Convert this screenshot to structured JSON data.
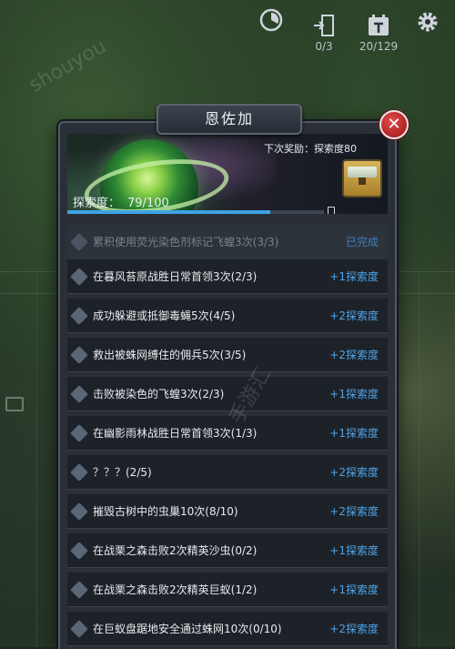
{
  "hud": {
    "exit_count": "0/3",
    "calendar_count": "20/129"
  },
  "dialog": {
    "title": "恩佐加",
    "close_label": "✕",
    "next_reward": "下次奖励：探索度80",
    "progress_label": "探索度：",
    "progress_value": "79/100",
    "progress_fraction": 0.79
  },
  "tasks": [
    {
      "label": "累积使用荧光染色剂标记飞蝗3次(3/3)",
      "reward": "已完成",
      "done": true
    },
    {
      "label": "在暮风苔原战胜日常首领3次(2/3)",
      "reward": "+1探索度",
      "done": false
    },
    {
      "label": "成功躲避或抵御毒蝇5次(4/5)",
      "reward": "+2探索度",
      "done": false
    },
    {
      "label": "救出被蛛网缚住的佣兵5次(3/5)",
      "reward": "+2探索度",
      "done": false
    },
    {
      "label": "击败被染色的飞蝗3次(2/3)",
      "reward": "+1探索度",
      "done": false
    },
    {
      "label": "在幽影雨林战胜日常首领3次(1/3)",
      "reward": "+1探索度",
      "done": false
    },
    {
      "label": "？？？(2/5)",
      "reward": "+2探索度",
      "done": false
    },
    {
      "label": "摧毁古树中的虫巢10次(8/10)",
      "reward": "+2探索度",
      "done": false
    },
    {
      "label": "在战栗之森击败2次精英沙虫(0/2)",
      "reward": "+1探索度",
      "done": false
    },
    {
      "label": "在战栗之森击败2次精英巨蚁(1/2)",
      "reward": "+1探索度",
      "done": false
    },
    {
      "label": "在巨蚁盘踞地安全通过蛛网10次(0/10)",
      "reward": "+2探索度",
      "done": false
    }
  ],
  "watermarks": [
    "shouyou",
    "手游汇"
  ]
}
